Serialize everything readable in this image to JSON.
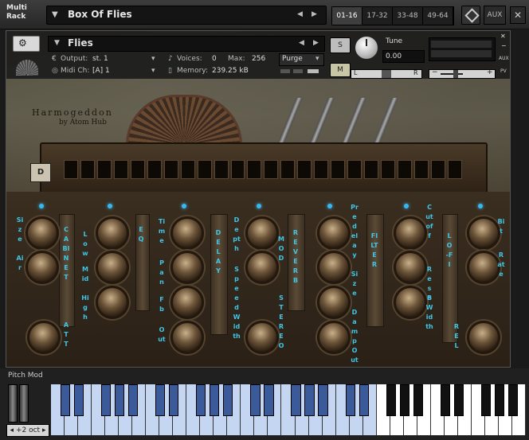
{
  "multirack": {
    "label_line1": "Multi",
    "label_line2": "Rack",
    "name": "Box Of Flies",
    "tabs": [
      "01-16",
      "17-32",
      "33-48",
      "49-64"
    ],
    "active_tab": 0,
    "aux_label": "AUX"
  },
  "instrument": {
    "name": "Flies",
    "output_label": "Output:",
    "output_value": "st. 1",
    "voices_label": "Voices:",
    "voices_value": "0",
    "max_label": "Max:",
    "max_value": "256",
    "purge_label": "Purge",
    "midi_label": "Midi Ch:",
    "midi_value": "[A] 1",
    "memory_label": "Memory:",
    "memory_value": "239.25 kB",
    "solo_label": "S",
    "mute_label": "M",
    "tune_label": "Tune",
    "tune_value": "0.00",
    "pan_left": "L",
    "pan_right": "R",
    "aux_small": "AUX",
    "pv_label": "PV"
  },
  "brand": {
    "title": "Harmogeddon",
    "subtitle": "by Atom Hub"
  },
  "harmonica_tag": "D",
  "panels": {
    "sect1_labels": [
      "Size",
      "Air"
    ],
    "cabinet": "CABINET",
    "att": "ATT",
    "eq_bands": [
      "Low",
      "Mid",
      "High"
    ],
    "eq": "EQ",
    "time_labels": [
      "Time",
      "Fb"
    ],
    "pan_labels": [
      "Pan",
      "Out"
    ],
    "delay": "DELAY",
    "mod_params": [
      "Depth",
      "Speed",
      "Width"
    ],
    "mod": "MOD",
    "stereo": "STEREO",
    "reverb": "REVERB",
    "reverb_params": [
      "Predelay",
      "Size",
      "Damp",
      "Out"
    ],
    "filter": "FILTER",
    "filter_params": [
      "Cutoff",
      "Reso",
      "BWidth"
    ],
    "lofi": "LO-FI",
    "bit_rate": [
      "Bit",
      "Rate"
    ],
    "rel": "REL"
  },
  "keyboard": {
    "pitch_mod_label": "Pitch Mod",
    "octave_label": "+2 oct"
  },
  "colors": {
    "label_cyan": "#3ec6e8",
    "keyboard_blue": "#c5d6f2"
  }
}
